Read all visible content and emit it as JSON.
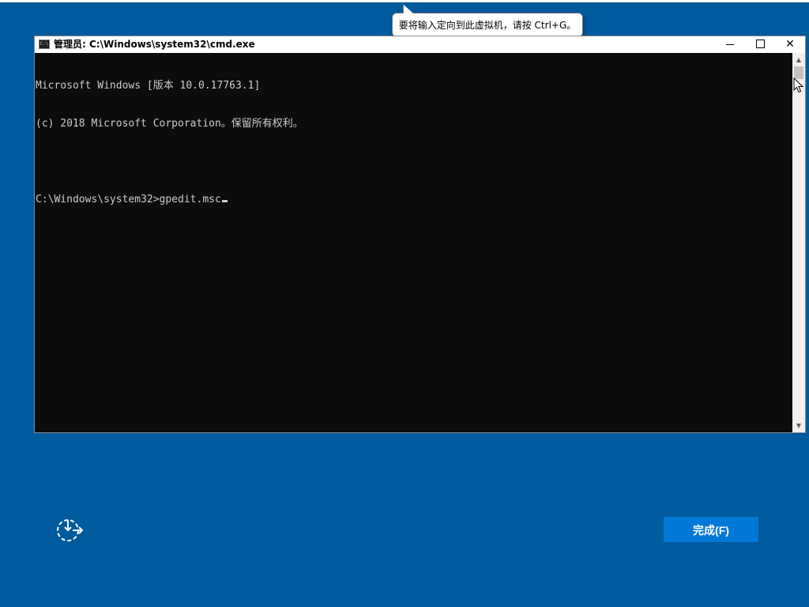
{
  "tooltip": {
    "text": "要将输入定向到此虚拟机，请按 Ctrl+G。"
  },
  "window": {
    "title": "管理员: C:\\Windows\\system32\\cmd.exe",
    "icon_glyph": "C:\\",
    "controls": {
      "minimize": "minimize-icon",
      "maximize": "maximize-icon",
      "close": "✕"
    }
  },
  "console": {
    "lines": [
      "Microsoft Windows [版本 10.0.17763.1]",
      "(c) 2018 Microsoft Corporation。保留所有权利。",
      "",
      "C:\\Windows\\system32>gpedit.msc"
    ]
  },
  "scrollbar": {
    "up": "▲",
    "down": "▼"
  },
  "footer": {
    "accessibility_icon": "accessibility-icon",
    "done_label": "完成(F)"
  },
  "colors": {
    "background": "#005a9e",
    "console_bg": "#0c0c0c",
    "console_text": "#cccccc",
    "button": "#0078d7"
  }
}
